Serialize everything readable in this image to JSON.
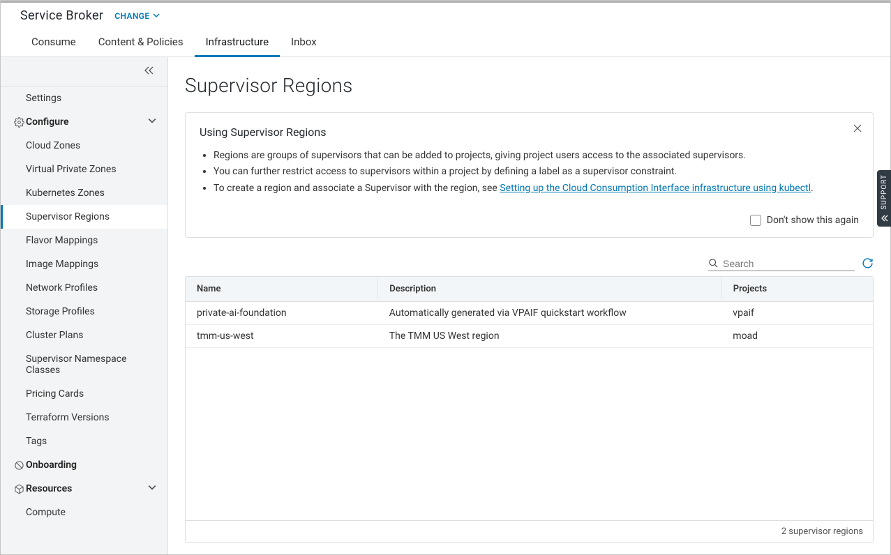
{
  "header": {
    "app_title": "Service Broker",
    "change_label": "CHANGE"
  },
  "tabs": [
    "Consume",
    "Content & Policies",
    "Infrastructure",
    "Inbox"
  ],
  "tabs_active_index": 2,
  "sidebar": {
    "settings": "Settings",
    "configure": {
      "label": "Configure",
      "items": [
        "Cloud Zones",
        "Virtual Private Zones",
        "Kubernetes Zones",
        "Supervisor Regions",
        "Flavor Mappings",
        "Image Mappings",
        "Network Profiles",
        "Storage Profiles",
        "Cluster Plans",
        "Supervisor Namespace Classes",
        "Pricing Cards",
        "Terraform Versions",
        "Tags"
      ],
      "active_index": 3
    },
    "onboarding": "Onboarding",
    "resources": {
      "label": "Resources",
      "items": [
        "Compute"
      ]
    }
  },
  "page": {
    "title": "Supervisor Regions",
    "info_title": "Using Supervisor Regions",
    "info_bullets": [
      "Regions are groups of supervisors that can be added to projects, giving project users access to the associated supervisors.",
      "You can further restrict access to supervisors within a project by defining a label as a supervisor constraint."
    ],
    "info_bullet3_prefix": "To create a region and associate a Supervisor with the region, see ",
    "info_bullet3_link": "Setting up the Cloud Consumption Interface infrastructure using kubectl",
    "info_bullet3_suffix": ".",
    "dont_show_label": "Don't show this again",
    "search_placeholder": "Search"
  },
  "table": {
    "columns": [
      "Name",
      "Description",
      "Projects"
    ],
    "rows": [
      {
        "name": "private-ai-foundation",
        "desc": "Automatically generated via VPAIF quickstart workflow",
        "proj": "vpaif"
      },
      {
        "name": "tmm-us-west",
        "desc": "The TMM US West region",
        "proj": "moad"
      }
    ],
    "footer": "2 supervisor regions"
  },
  "support_tab": "SUPPORT"
}
